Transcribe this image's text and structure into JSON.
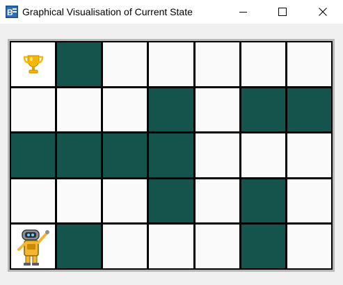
{
  "window": {
    "title": "Graphical Visualisation of Current State",
    "icon": "app-icon",
    "buttons": [
      "minimize",
      "maximize",
      "close"
    ]
  },
  "grid": {
    "rows": 5,
    "cols": 7,
    "colors": {
      "wall": "#14544c",
      "empty": "#fafafa",
      "border": "#000000"
    },
    "cells": [
      [
        "goal",
        "wall",
        "empty",
        "empty",
        "empty",
        "empty",
        "empty"
      ],
      [
        "empty",
        "empty",
        "empty",
        "wall",
        "empty",
        "wall",
        "wall"
      ],
      [
        "wall",
        "wall",
        "wall",
        "wall",
        "empty",
        "empty",
        "empty"
      ],
      [
        "empty",
        "empty",
        "empty",
        "wall",
        "empty",
        "wall",
        "empty"
      ],
      [
        "agent",
        "wall",
        "empty",
        "empty",
        "empty",
        "wall",
        "empty"
      ]
    ],
    "goal_icon": "trophy-icon",
    "agent_icon": "robot-icon"
  }
}
